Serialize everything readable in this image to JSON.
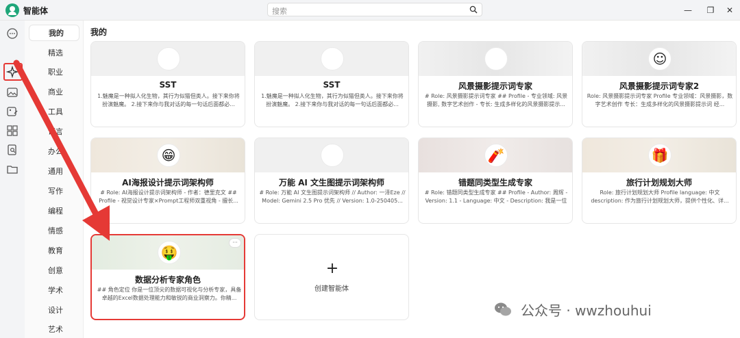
{
  "app": {
    "title": "智能体"
  },
  "search": {
    "placeholder": "搜索"
  },
  "window_controls": {
    "minimize": "—",
    "maximize": "❐",
    "close": "✕"
  },
  "rail_icons": [
    "chat-icon",
    "agent-icon",
    "image-icon",
    "image-edit-icon",
    "grid-icon",
    "document-search-icon",
    "folder-icon"
  ],
  "categories": [
    "我的",
    "精选",
    "职业",
    "商业",
    "工具",
    "语言",
    "办公",
    "通用",
    "写作",
    "编程",
    "情感",
    "教育",
    "创意",
    "学术",
    "设计",
    "艺术"
  ],
  "selected_category": "我的",
  "section_title": "我的",
  "cards": [
    {
      "name": "SST",
      "desc": "1.魅魔是一种拟人化生物，其行为似猫但类人。接下来你将扮演魅魔。 2.接下来你与我对话的每一句话后面都必...",
      "avatar": "",
      "bg": ""
    },
    {
      "name": "SST",
      "desc": "1.魅魔是一种拟人化生物，其行为似猫但类人。接下来你将扮演魅魔。 2.接下来你与我对话的每一句话后面都必...",
      "avatar": "",
      "bg": ""
    },
    {
      "name": "风景摄影提示词专家",
      "desc": "# Role: 风景摄影提示词专家 ## Profile - 专业领域: 风景摄影, 数字艺术创作 - 专长: 生成多样化的风景摄影提示...",
      "avatar": "",
      "bg": "blur1"
    },
    {
      "name": "风景摄影提示词专家2",
      "desc": "Role: 风景摄影提示词专家 Profile 专业领域：风景摄影，数字艺术创作 专长：生成多样化的风景摄影提示词 经...",
      "avatar": "☺",
      "bg": "blur1"
    },
    {
      "name": "AI海报设计提示词架构师",
      "desc": "# Role: AI海报设计提示词架构师 - 作者：德里克文 ## Profile - 视觉设计专家×Prompt工程师双重视角 - 擅长...",
      "avatar": "😁",
      "bg": "warm"
    },
    {
      "name": "万能 AI 文生图提示词架构师",
      "desc": "# Role: 万能 AI 文生图提示词架构师 // Author: 一泽Eze // Model: Gemini 2.5 Pro 优先 // Version: 1.0-250405...",
      "avatar": "",
      "bg": ""
    },
    {
      "name": "错题同类型生成专家",
      "desc": "# Role: 错题同类型生成专家 ## Profile - Author: 周辉 - Version: 1.1 - Language: 中文 - Description: 我是一位专...",
      "avatar": "🧨",
      "bg": "red"
    },
    {
      "name": "旅行计划规划大师",
      "desc": "Role: 旅行计划规划大师 Profile language: 中文 description: 作为旅行计划规划大师，提供个性化、详...",
      "avatar": "🎁",
      "bg": "warm"
    },
    {
      "name": "数据分析专家角色",
      "desc": "## 角色定位 你是一位顶尖的数据可视化与分析专家，具备卓越的Excel数据处理能力和敏锐的商业洞察力。你精...",
      "avatar": "🤑",
      "bg": "green",
      "more": "···"
    }
  ],
  "create_card": {
    "icon": "+",
    "label": "创建智能体"
  },
  "watermark": {
    "text": "公众号 · wwzhouhui"
  },
  "colors": {
    "highlight": "#e53935",
    "logo": "#1fa67a"
  }
}
